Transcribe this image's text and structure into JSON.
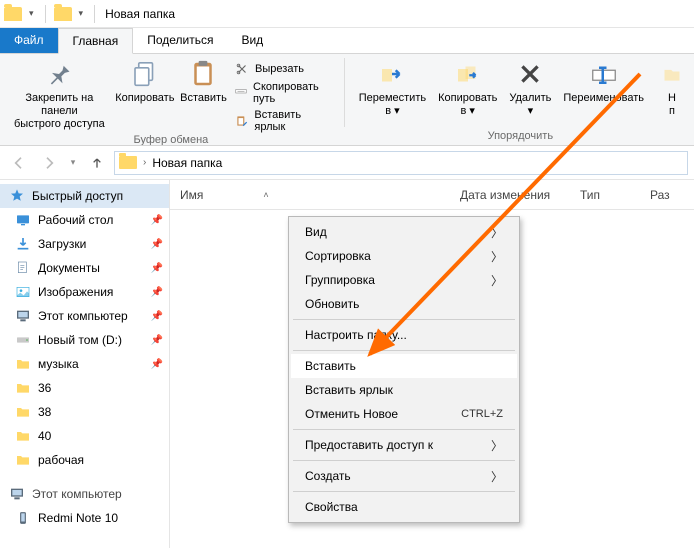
{
  "title": "Новая папка",
  "tabs": {
    "file": "Файл",
    "home": "Главная",
    "share": "Поделиться",
    "view": "Вид"
  },
  "ribbon": {
    "pin": "Закрепить на панели\nбыстрого доступа",
    "copy": "Копировать",
    "paste": "Вставить",
    "cut": "Вырезать",
    "copypath": "Скопировать путь",
    "pastelink": "Вставить ярлык",
    "clipboard_group": "Буфер обмена",
    "moveto": "Переместить\nв ▾",
    "copyto": "Копировать\nв ▾",
    "delete": "Удалить\n▾",
    "rename": "Переименовать",
    "newfolder_partial": "Н\nп",
    "organize_group": "Упорядочить"
  },
  "address": {
    "segment": "Новая папка"
  },
  "columns": {
    "name": "Имя",
    "date": "Дата изменения",
    "type": "Тип",
    "size": "Раз"
  },
  "sidebar": {
    "quick": "Быстрый доступ",
    "items": [
      {
        "label": "Рабочий стол",
        "pinned": true,
        "icon": "desktop"
      },
      {
        "label": "Загрузки",
        "pinned": true,
        "icon": "downloads"
      },
      {
        "label": "Документы",
        "pinned": true,
        "icon": "documents"
      },
      {
        "label": "Изображения",
        "pinned": true,
        "icon": "pictures"
      },
      {
        "label": "Этот компьютер",
        "pinned": true,
        "icon": "pc"
      },
      {
        "label": "Новый том (D:)",
        "pinned": true,
        "icon": "drive"
      },
      {
        "label": "музыка",
        "pinned": true,
        "icon": "folder"
      },
      {
        "label": "36",
        "pinned": false,
        "icon": "folder"
      },
      {
        "label": "38",
        "pinned": false,
        "icon": "folder"
      },
      {
        "label": "40",
        "pinned": false,
        "icon": "folder"
      },
      {
        "label": "рабочая",
        "pinned": false,
        "icon": "folder"
      }
    ],
    "thispc": "Этот компьютер",
    "phone": "Redmi Note 10"
  },
  "context": {
    "view": "Вид",
    "sort": "Сортировка",
    "group": "Группировка",
    "refresh": "Обновить",
    "customize": "Настроить папку...",
    "paste": "Вставить",
    "pastelink": "Вставить ярлык",
    "undo": "Отменить Новое",
    "undo_shortcut": "CTRL+Z",
    "share": "Предоставить доступ к",
    "new": "Создать",
    "properties": "Свойства"
  }
}
